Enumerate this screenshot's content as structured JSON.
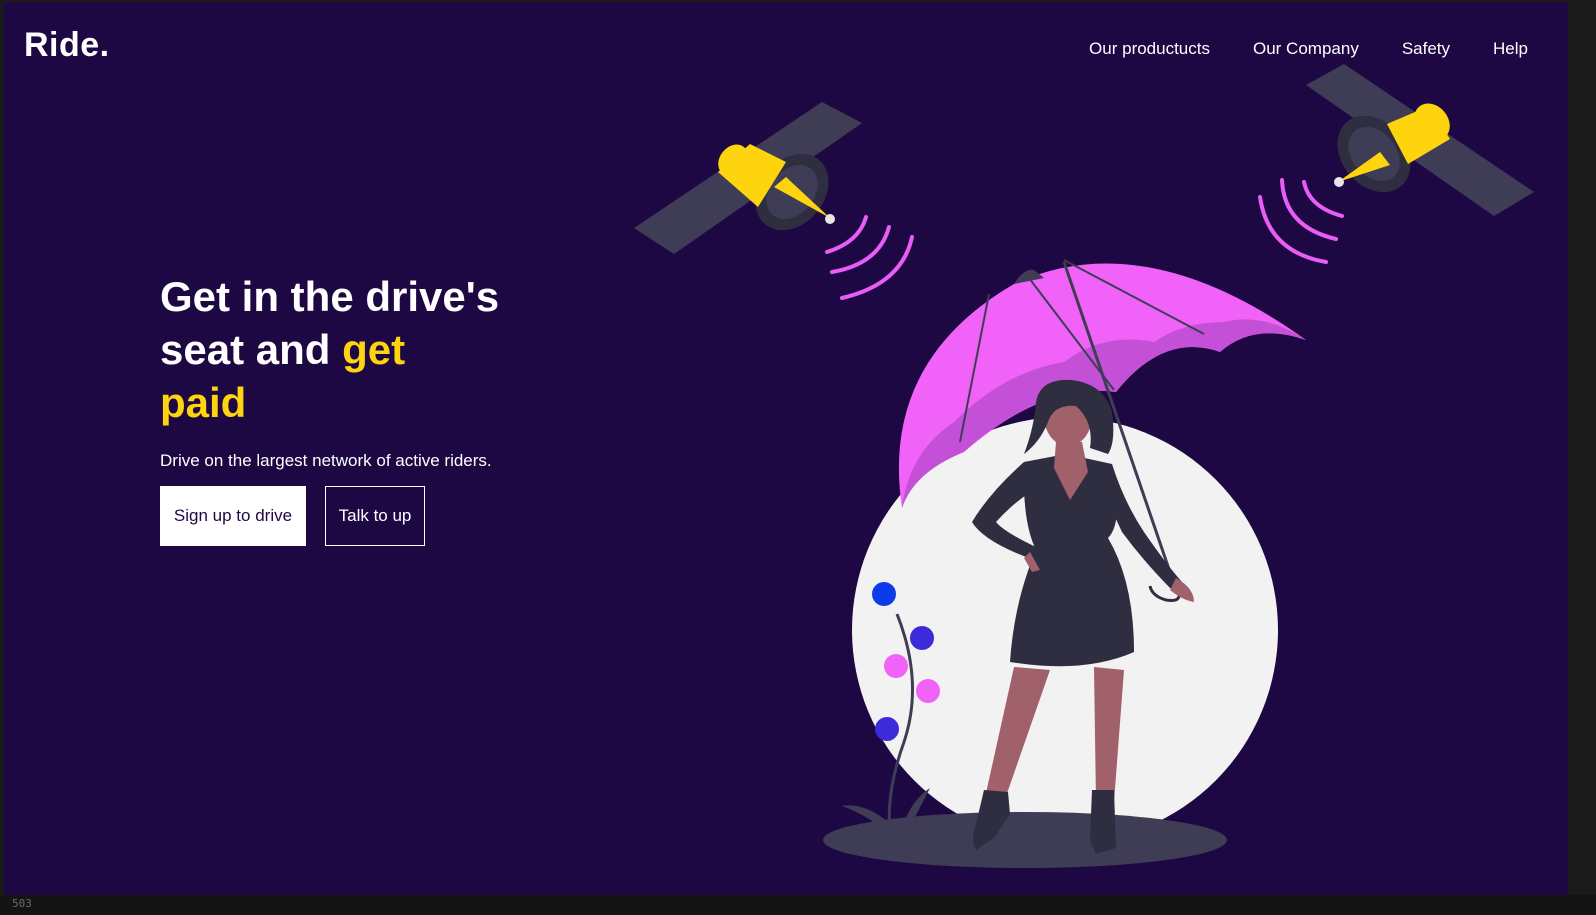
{
  "brand": {
    "logo": "Ride."
  },
  "nav": {
    "items": [
      {
        "label": "Our productucts"
      },
      {
        "label": "Our Company"
      },
      {
        "label": "Safety"
      },
      {
        "label": "Help"
      }
    ]
  },
  "hero": {
    "title_line1": "Get in the drive's",
    "title_line2_plain": "seat and ",
    "title_line2_accent": "get",
    "title_line3_accent": "paid",
    "subtitle": "Drive on the largest network of active riders.",
    "primary_button": "Sign up to drive",
    "secondary_button": "Talk to up"
  },
  "editor": {
    "line_hint": "503"
  },
  "illustration": {
    "elements": [
      "satellite-left",
      "satellite-right",
      "signal-waves",
      "umbrella",
      "woman-figure",
      "moon-circle",
      "flower-plant",
      "ground-shadow"
    ]
  },
  "colors": {
    "background": "#1e0843",
    "accent": "#fdd40e",
    "text": "#ffffff",
    "umbrella": "#f062f8",
    "umbrella_shade": "#c450d8",
    "satellite_panel": "#3f3d56",
    "moon": "#f2f2f2",
    "dress": "#2f2e41",
    "skin": "#a0616a"
  }
}
